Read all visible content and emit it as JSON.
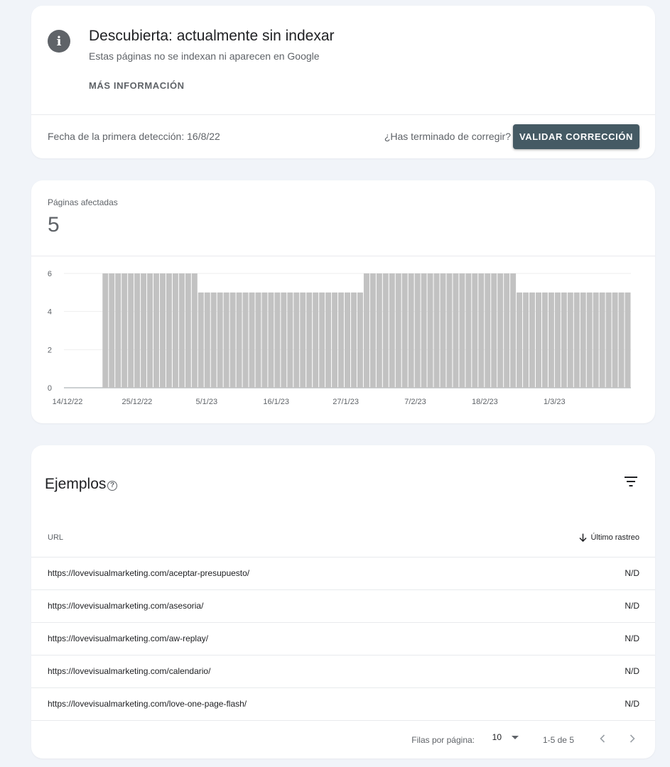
{
  "issue": {
    "icon": "info-icon",
    "title": "Descubierta: actualmente sin indexar",
    "subtitle": "Estas páginas no se indexan ni aparecen en Google",
    "learn_more": "MÁS INFORMACIÓN",
    "first_detected": "Fecha de la primera detección: 16/8/22",
    "fix_question": "¿Has terminado de corregir?",
    "validate_label": "VALIDAR CORRECCIÓN"
  },
  "metric": {
    "label": "Páginas afectadas",
    "value": "5"
  },
  "chart_data": {
    "type": "bar",
    "title": "",
    "xlabel": "",
    "ylabel": "",
    "ylim": [
      0,
      6
    ],
    "yticks": [
      "0",
      "2",
      "4",
      "6"
    ],
    "xtick_labels": [
      "14/12/22",
      "25/12/22",
      "5/1/23",
      "16/1/23",
      "27/1/23",
      "7/2/23",
      "18/2/23",
      "1/3/23"
    ],
    "grid": true,
    "bar_color": "#c2c2c2",
    "values": [
      0,
      0,
      0,
      0,
      0,
      0,
      6,
      6,
      6,
      6,
      6,
      6,
      6,
      6,
      6,
      6,
      6,
      6,
      6,
      6,
      6,
      5,
      5,
      5,
      5,
      5,
      5,
      5,
      5,
      5,
      5,
      5,
      5,
      5,
      5,
      5,
      5,
      5,
      5,
      5,
      5,
      5,
      5,
      5,
      5,
      5,
      5,
      6,
      6,
      6,
      6,
      6,
      6,
      6,
      6,
      6,
      6,
      6,
      6,
      6,
      6,
      6,
      6,
      6,
      6,
      6,
      6,
      6,
      6,
      6,
      6,
      5,
      5,
      5,
      5,
      5,
      5,
      5,
      5,
      5,
      5,
      5,
      5,
      5,
      5,
      5,
      5,
      5,
      5
    ]
  },
  "examples": {
    "title": "Ejemplos",
    "help_icon": "help-icon",
    "filter_icon": "filter-icon",
    "col_url": "URL",
    "col_crawl": "Último rastreo",
    "sort_icon": "arrow-down-icon",
    "rows": [
      {
        "url": "https://lovevisualmarketing.com/aceptar-presupuesto/",
        "crawl": "N/D"
      },
      {
        "url": "https://lovevisualmarketing.com/asesoria/",
        "crawl": "N/D"
      },
      {
        "url": "https://lovevisualmarketing.com/aw-replay/",
        "crawl": "N/D"
      },
      {
        "url": "https://lovevisualmarketing.com/calendario/",
        "crawl": "N/D"
      },
      {
        "url": "https://lovevisualmarketing.com/love-one-page-flash/",
        "crawl": "N/D"
      }
    ],
    "pagination": {
      "rows_label": "Filas por página:",
      "rows_value": "10",
      "range": "1-5 de 5",
      "prev_icon": "chevron-left-icon",
      "next_icon": "chevron-right-icon"
    }
  }
}
